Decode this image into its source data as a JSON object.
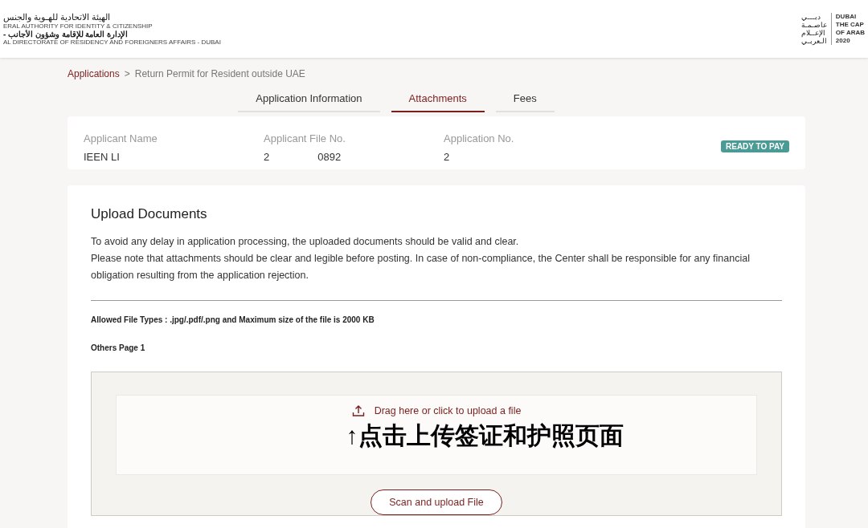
{
  "header": {
    "left_logo": {
      "arabic_1": "الهيئة الاتحادية للهـوية والجنس",
      "english_1": "ERAL AUTHORITY FOR IDENTITY & CITIZENSHIP",
      "arabic_2": "الإدارة العامة للإقامة وشؤون الأجانب -",
      "english_2": "AL DIRECTORATE OF RESIDENCY AND FOREIGNERS AFFAIRS - DUBAI"
    },
    "right_logo": {
      "arabic_lines": [
        "دبـــي",
        "عاصـمـة",
        "الإعــلام",
        "الـعربـي"
      ],
      "english_lines": [
        "DUBAI",
        "THE CAP",
        "OF ARAB",
        "2020"
      ]
    }
  },
  "breadcrumb": {
    "link": "Applications",
    "separator": ">",
    "current": "Return Permit for Resident outside UAE"
  },
  "tabs": [
    {
      "label": "Application Information",
      "selected": false
    },
    {
      "label": "Attachments",
      "selected": true
    },
    {
      "label": "Fees",
      "selected": false
    }
  ],
  "summary": {
    "fields": [
      {
        "label": "Applicant Name",
        "value_start": "IEEN LI"
      },
      {
        "label": "Applicant File No.",
        "value_start": "2",
        "value_end": "0892"
      },
      {
        "label": "Application No.",
        "value_start": "2"
      }
    ],
    "status": "READY TO PAY"
  },
  "upload": {
    "title": "Upload Documents",
    "paragraphs": [
      "To avoid any delay in application processing, the uploaded documents should be valid and clear.",
      "Please note that attachments should be clear and legible before posting. In case of non-compliance, the Center shall be responsible for any financial obligation resulting from the application rejection."
    ],
    "allowed": "Allowed File Types : .jpg/.pdf/.png and Maximum size of the file is 2000 KB",
    "document_label": "Others Page 1",
    "dropzone": "Drag here or click to upload a file",
    "annotation": "↑点击上传签证和护照页面",
    "scan_button": "Scan and upload File"
  }
}
